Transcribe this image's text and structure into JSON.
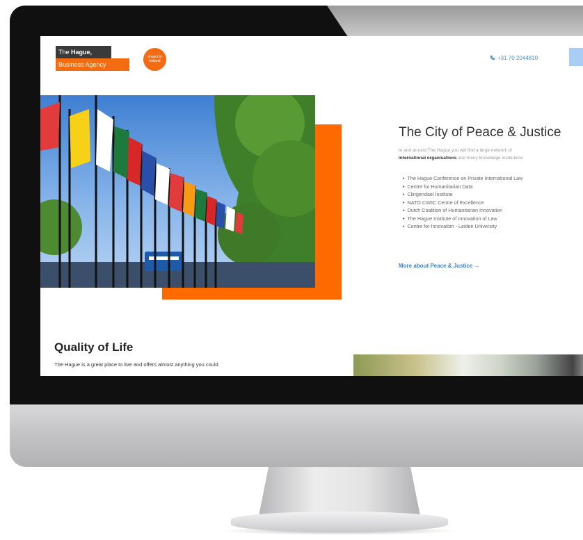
{
  "header": {
    "logo": {
      "line1_prefix": "The",
      "line1_bold": "Hague,",
      "line2": "Business Agency"
    },
    "badge_text": "impact in holland",
    "phone": "+31 70 2044810"
  },
  "peace_section": {
    "title": "The City of Peace & Justice",
    "intro_line1": "In and around The Hague you will find a large network of",
    "intro_bold": "international organisations",
    "intro_rest": " and many knowledge institutions",
    "organisations": [
      "The Hague Conference on Private International Law",
      "Centre for Humanitarian Data",
      "Clingendael Institute",
      "NATO CIMIC Centre of Excellence",
      "Dutch Coalition of Humanitarian Innovation",
      "The Hague Institute of Innovation of Law",
      "Centre for Innovation - Leiden University"
    ],
    "more_link": "More about Peace & Justice →"
  },
  "quality_section": {
    "title": "Quality of Life",
    "text": "The Hague is a great place to live and offers almost anything you could"
  },
  "colors": {
    "brand_orange": "#ff6a00",
    "link_blue": "#3b82d8",
    "dark": "#3a3a3a"
  }
}
